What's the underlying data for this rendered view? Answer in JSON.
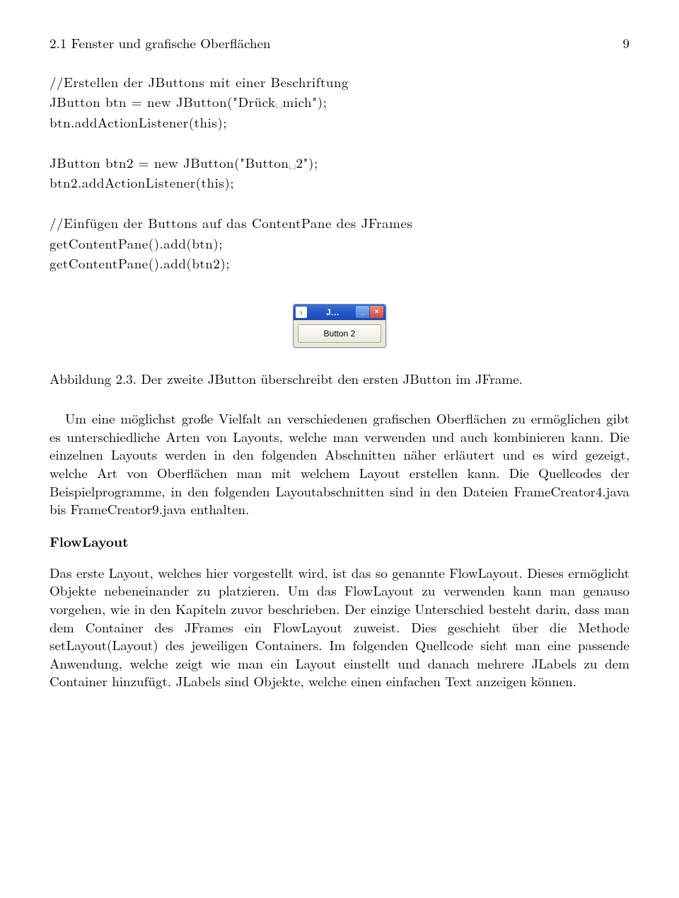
{
  "header": {
    "section": "2.1 Fenster und grafische Oberflächen",
    "page": "9"
  },
  "code": "//Erstellen der JButtons mit einer Beschriftung\nJButton btn = new JButton(\"Drück␣mich\");\nbtn.addActionListener(this);\n\nJButton btn2 = new JButton(\"Button␣2\");\nbtn2.addActionListener(this);\n\n//Einfügen der Buttons auf das ContentPane des JFrames\ngetContentPane().add(btn);\ngetContentPane().add(btn2);",
  "figure": {
    "windowTitle": "J…",
    "buttonLabel": "Button 2",
    "caption": "Abbildung 2.3. Der zweite JButton überschreibt den ersten JButton im JFrame."
  },
  "para1": "Um eine möglichst große Vielfalt an verschiedenen grafischen Oberflächen zu ermöglichen gibt es unterschiedliche Arten von Layouts, welche man verwenden und auch kombinieren kann. Die einzelnen Layouts werden in den folgenden Abschnitten näher erläutert und es wird gezeigt, welche Art von Oberflächen man mit welchem Layout erstellen kann. Die Quellcodes der Beispielprogramme, in den folgenden Layoutabschnitten sind in den Dateien FrameCreator4.java bis FrameCreator9.java enthalten.",
  "heading1": "FlowLayout",
  "para2": "Das erste Layout, welches hier vorgestellt wird, ist das so genannte FlowLayout. Dieses ermöglicht Objekte nebeneinander zu platzieren. Um das FlowLayout zu verwenden kann man genauso vorgehen, wie in den Kapiteln zuvor beschrieben. Der einzige Unterschied besteht darin, dass man dem Container des JFrames ein FlowLayout zuweist. Dies geschieht über die Methode setLayout(Layout) des jeweiligen Containers. Im folgenden Quellcode sieht man eine passende Anwendung, welche zeigt wie man ein Layout einstellt und danach mehrere JLabels zu dem Container hinzufügt. JLabels sind Objekte, welche einen einfachen Text anzeigen können."
}
